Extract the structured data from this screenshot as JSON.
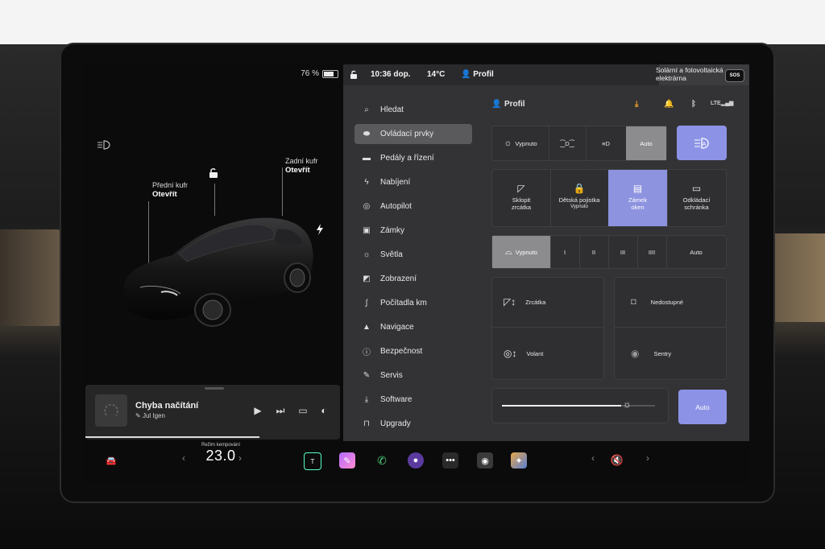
{
  "car": {
    "battery_pct": "76 %",
    "battery_level": 0.76,
    "frunk_label": "Přední kufr",
    "frunk_state": "Otevřít",
    "trunk_label": "Zadní kufr",
    "trunk_state": "Otevřít"
  },
  "media": {
    "title": "Chyba načítání",
    "subtitle": "Jul Igen"
  },
  "status": {
    "time": "10:36 dop.",
    "temperature": "14°C",
    "profile": "Profil",
    "map_label_line1": "Solární a fotovoltaická",
    "map_label_line2": "elektrárna",
    "sos": "SOS"
  },
  "nav": [
    {
      "label": "Hledat",
      "icon": "search-icon"
    },
    {
      "label": "Ovládací prvky",
      "icon": "toggle-icon",
      "active": true
    },
    {
      "label": "Pedály a řízení",
      "icon": "car-icon"
    },
    {
      "label": "Nabíjení",
      "icon": "bolt-icon"
    },
    {
      "label": "Autopilot",
      "icon": "steering-wheel-icon"
    },
    {
      "label": "Zámky",
      "icon": "lock-icon"
    },
    {
      "label": "Světla",
      "icon": "sun-icon"
    },
    {
      "label": "Zobrazení",
      "icon": "display-icon"
    },
    {
      "label": "Počítadla km",
      "icon": "odometer-icon"
    },
    {
      "label": "Navigace",
      "icon": "navigation-icon"
    },
    {
      "label": "Bezpečnost",
      "icon": "shield-icon"
    },
    {
      "label": "Servis",
      "icon": "wrench-icon"
    },
    {
      "label": "Software",
      "icon": "download-icon"
    },
    {
      "label": "Upgrady",
      "icon": "bag-icon"
    }
  ],
  "controls": {
    "profile": "Profil",
    "lights": {
      "off": "Vypnuto",
      "auto": "Auto",
      "selected": "Auto"
    },
    "quick": {
      "fold_mirrors_line1": "Sklopit",
      "fold_mirrors_line2": "zrcátka",
      "child_lock_line1": "Dětská pojistka",
      "child_lock_line2": "Vypnuto",
      "window_lock_line1": "Zámek",
      "window_lock_line2": "oken",
      "glovebox_line1": "Odkládací",
      "glovebox_line2": "schránka"
    },
    "wipers": {
      "off": "Vypnuto",
      "s1": "I",
      "s2": "II",
      "s3": "III",
      "s4": "IIII",
      "auto": "Auto"
    },
    "mirrors": "Zrcátka",
    "wheel": "Volant",
    "unavailable": "Nedostupné",
    "sentry": "Sentry",
    "brightness_auto": "Auto",
    "brightness_level": 0.82
  },
  "taskbar": {
    "mode_label": "Režim kempování",
    "temperature": "23.0"
  },
  "colors": {
    "accent": "#8c93e6",
    "panel": "#333335",
    "download": "#f0a12a",
    "alert": "#e24a4a"
  }
}
